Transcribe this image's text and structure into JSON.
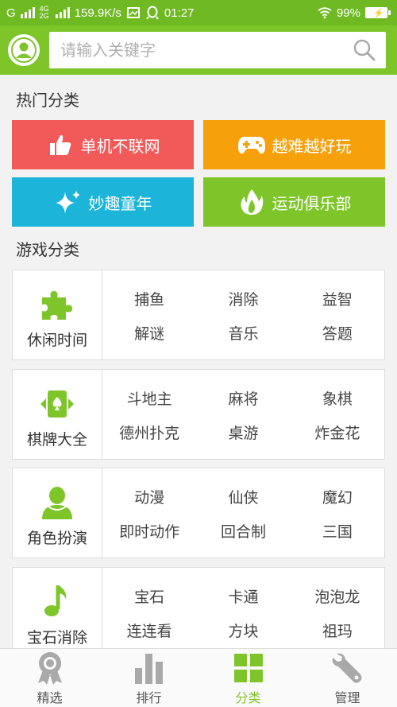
{
  "status_bar": {
    "carrier": "G",
    "net_top": "4G",
    "net_bottom": "2G",
    "speed": "159.9K/s",
    "time": "01:27",
    "battery": "99%"
  },
  "search": {
    "placeholder": "请输入关键字"
  },
  "hot_section": {
    "title": "热门分类",
    "tiles": [
      {
        "label": "单机不联网",
        "color": "#f25a5a",
        "icon": "thumbs-up-icon"
      },
      {
        "label": "越难越好玩",
        "color": "#f6a10c",
        "icon": "gamepad-icon"
      },
      {
        "label": "妙趣童年",
        "color": "#1cb4d8",
        "icon": "sparkle-icon"
      },
      {
        "label": "运动俱乐部",
        "color": "#7ec52a",
        "icon": "flame-icon"
      }
    ]
  },
  "game_section": {
    "title": "游戏分类",
    "categories": [
      {
        "name": "休闲时间",
        "icon": "puzzle-icon",
        "tags": [
          "捕鱼",
          "消除",
          "益智",
          "解谜",
          "音乐",
          "答题"
        ]
      },
      {
        "name": "棋牌大全",
        "icon": "card-icon",
        "tags": [
          "斗地主",
          "麻将",
          "象棋",
          "德州扑克",
          "桌游",
          "炸金花"
        ]
      },
      {
        "name": "角色扮演",
        "icon": "person-icon",
        "tags": [
          "动漫",
          "仙侠",
          "魔幻",
          "即时动作",
          "回合制",
          "三国"
        ]
      },
      {
        "name": "宝石消除",
        "icon": "music-note-icon",
        "tags": [
          "宝石",
          "卡通",
          "泡泡龙",
          "连连看",
          "方块",
          "祖玛"
        ]
      }
    ]
  },
  "bottom_nav": {
    "items": [
      {
        "label": "精选",
        "icon": "award-icon",
        "active": false
      },
      {
        "label": "排行",
        "icon": "bar-chart-icon",
        "active": false
      },
      {
        "label": "分类",
        "icon": "grid-icon",
        "active": true
      },
      {
        "label": "管理",
        "icon": "wrench-icon",
        "active": false
      }
    ]
  },
  "colors": {
    "brand_green": "#7ec52a",
    "status_green": "#6fba23",
    "icon_gray": "#a9a9a9"
  }
}
